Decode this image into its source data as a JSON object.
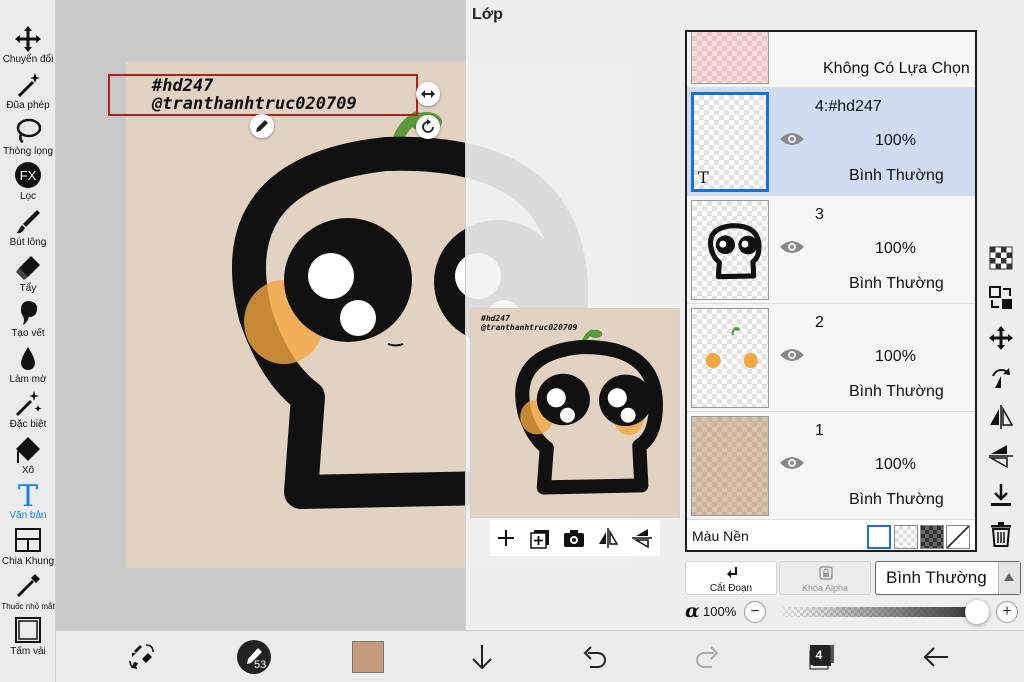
{
  "toolbar": {
    "tools": [
      {
        "label": "Chuyển đổi",
        "icon": "move-icon"
      },
      {
        "label": "Đũa phép",
        "icon": "magic-wand-icon"
      },
      {
        "label": "Thòng lọng",
        "icon": "lasso-icon"
      },
      {
        "label": "Lọc",
        "icon": "fx-icon",
        "glyph": "FX"
      },
      {
        "label": "Bút lông",
        "icon": "brush-icon"
      },
      {
        "label": "Tẩy",
        "icon": "eraser-icon"
      },
      {
        "label": "Tạo vết",
        "icon": "smudge-icon"
      },
      {
        "label": "Làm mờ",
        "icon": "blur-icon"
      },
      {
        "label": "Đặc biệt",
        "icon": "special-icon"
      },
      {
        "label": "Xô",
        "icon": "bucket-icon"
      },
      {
        "label": "Văn bản",
        "icon": "text-icon",
        "glyph": "T",
        "active": true
      },
      {
        "label": "Chia Khung",
        "icon": "frame-divider-icon"
      },
      {
        "label": "Thuốc nhỏ mắt",
        "icon": "eyedropper-icon"
      },
      {
        "label": "Tấm vải",
        "icon": "canvas-icon"
      }
    ]
  },
  "canvas": {
    "text_lines": [
      "#hd247",
      "@tranthanhtruc020709"
    ],
    "background_color": "#e2d2c2"
  },
  "layer_panel": {
    "title": "Lớp",
    "top_label": "Không Có Lựa Chọn",
    "thumb_glyph": "T",
    "layers": [
      {
        "name": "4:#hd247",
        "opacity": "100%",
        "mode": "Bình Thường",
        "selected": true
      },
      {
        "name": "3",
        "opacity": "100%",
        "mode": "Bình Thường",
        "selected": false
      },
      {
        "name": "2",
        "opacity": "100%",
        "mode": "Bình Thường",
        "selected": false
      },
      {
        "name": "1",
        "opacity": "100%",
        "mode": "Bình Thường",
        "selected": false
      }
    ],
    "background_label": "Màu Nền",
    "clip_label": "Cắt Đoạn",
    "alpha_lock_label": "Khóa Alpha",
    "blend_mode": "Bình Thường",
    "alpha_symbol": "α",
    "opacity": "100%",
    "opacity_fraction": 1.0,
    "minus": "−",
    "plus": "+"
  },
  "bottom_bar": {
    "brush_size": "53",
    "layer_count": "4",
    "current_color": "#c49a78"
  },
  "colors": {
    "accent": "#1a7df0",
    "selection_box": "#b02020",
    "sprout": "#5a9a3a",
    "blush": "#f5a640"
  }
}
